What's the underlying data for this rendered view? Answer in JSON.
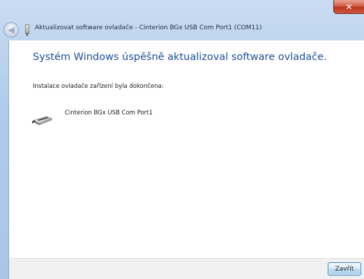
{
  "window": {
    "title": "Aktualizovat software ovladače - Cinterion BGx USB Com Port1 (COM11)",
    "close_glyph": "✕",
    "back_glyph": "◀"
  },
  "main": {
    "heading": "Systém Windows úspěšně aktualizoval software ovladače.",
    "status": "Instalace ovladače zařízení byla dokončena:",
    "device_name": "Cinterion BGx USB Com Port1"
  },
  "footer": {
    "close_label": "Zavřít"
  },
  "icons": {
    "back": "back-arrow-icon",
    "usb": "usb-device-icon",
    "device": "serial-port-icon",
    "close": "close-icon"
  },
  "colors": {
    "heading": "#1e4fa0",
    "titlebar": "#aecbea",
    "close_button": "#cf5a43"
  }
}
